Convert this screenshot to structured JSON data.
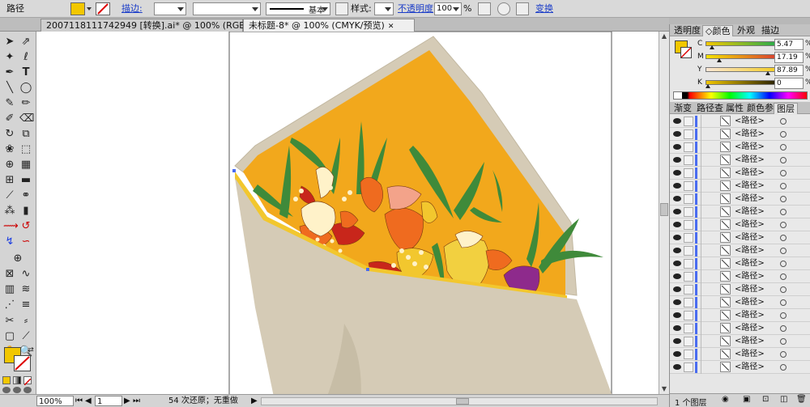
{
  "control_bar": {
    "object_type": "路径",
    "fill_color": "#f2c700",
    "stroke_label": "描边:",
    "stroke_weight": "",
    "brush_label": "基本",
    "style_label": "样式:",
    "opacity_label": "不透明度",
    "opacity_value": "100",
    "opacity_unit": "%",
    "transform_label": "变换"
  },
  "tabs": [
    {
      "label": "2007118111742949 [转换].ai* @ 100% (RGB/预览)",
      "active": false
    },
    {
      "label": "未标题-8* @ 100% (CMYK/预览)",
      "active": true
    }
  ],
  "color_panel": {
    "tabs": [
      "透明度",
      "颜色",
      "外观",
      "描边"
    ],
    "active_tab": "颜色",
    "fill": "#f2c700",
    "channels": [
      {
        "name": "C",
        "value": "5.47",
        "pos": 0.055
      },
      {
        "name": "M",
        "value": "17.19",
        "pos": 0.17
      },
      {
        "name": "Y",
        "value": "87.89",
        "pos": 0.88
      },
      {
        "name": "K",
        "value": "0",
        "pos": 0.0
      }
    ],
    "unit": "%"
  },
  "layers_panel": {
    "tabs": [
      "渐变",
      "路径查",
      "属性",
      "颜色参",
      "图层"
    ],
    "active_tab": "图层",
    "item_name": "<路径>",
    "rows": 20,
    "footer_label": "1 个图层"
  },
  "status_bar": {
    "zoom": "100%",
    "page": "1",
    "info": "54 次还原；无重做"
  },
  "colors": {
    "wrap_paper": "#d5cbb6",
    "wrap_inner": "#f2a81c",
    "gold_edge": "#f2c72e",
    "leaf": "#3f8a3a",
    "orange": "#ef6b1f",
    "red": "#c8261b",
    "purple": "#8e2a8c",
    "cream": "#fff2c9"
  }
}
